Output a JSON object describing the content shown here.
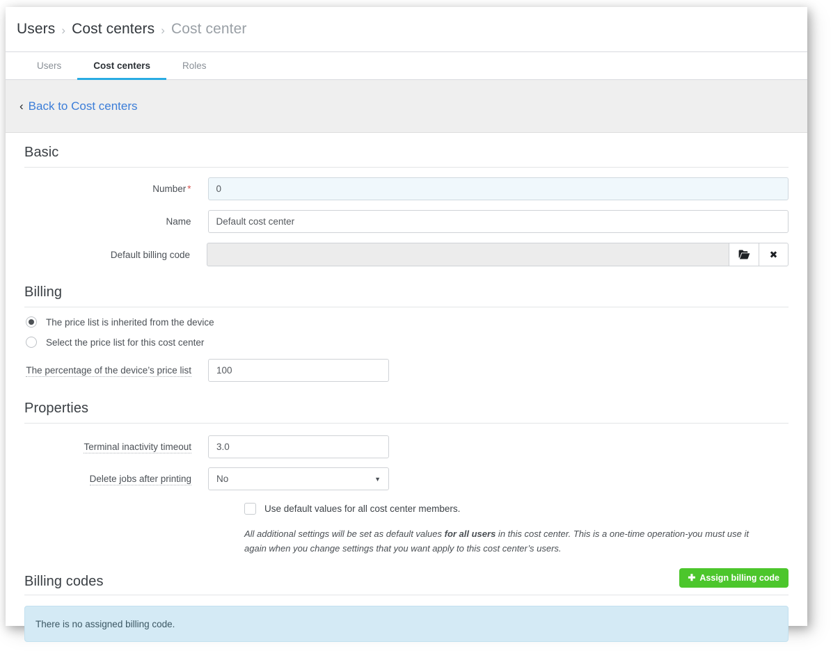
{
  "breadcrumb": {
    "items": [
      {
        "label": "Users",
        "current": false
      },
      {
        "label": "Cost centers",
        "current": false
      },
      {
        "label": "Cost center",
        "current": true
      }
    ],
    "separator": "›"
  },
  "tabs": [
    {
      "label": "Users",
      "active": false
    },
    {
      "label": "Cost centers",
      "active": true
    },
    {
      "label": "Roles",
      "active": false
    }
  ],
  "back_link": {
    "chevron": "‹",
    "label": "Back to Cost centers"
  },
  "basic": {
    "title": "Basic",
    "number": {
      "label": "Number",
      "required_marker": "*",
      "value": "0"
    },
    "name": {
      "label": "Name",
      "value": "Default cost center"
    },
    "default_billing_code": {
      "label": "Default billing code",
      "value": "",
      "browse_icon": "folder-open-icon",
      "clear_icon": "close-icon",
      "browse_glyph": "📂",
      "clear_glyph": "✖"
    }
  },
  "billing": {
    "title": "Billing",
    "options": [
      {
        "label": "The price list is inherited from the device",
        "selected": true
      },
      {
        "label": "Select the price list for this cost center",
        "selected": false
      }
    ],
    "percentage": {
      "label": "The percentage of the device’s price list",
      "value": "100"
    }
  },
  "properties": {
    "title": "Properties",
    "terminal_timeout": {
      "label": "Terminal inactivity timeout",
      "value": "3.0"
    },
    "delete_jobs": {
      "label": "Delete jobs after printing",
      "value": "No",
      "caret": "▼"
    },
    "use_defaults": {
      "label": "Use default values for all cost center members.",
      "checked": false
    },
    "help_text_1": "All additional settings will be set as default values ",
    "help_text_bold": "for all users",
    "help_text_2": " in this cost center. This is a one-time operation-you must use it again when you change settings that you want apply to this cost center’s users."
  },
  "billing_codes": {
    "title": "Billing codes",
    "assign_button": {
      "label": "Assign billing code",
      "plus": "✚"
    },
    "empty_message": "There is no assigned billing code."
  },
  "colors": {
    "accent_tab": "#29abe2",
    "link": "#3b7dd8",
    "green_button": "#4cc62c",
    "required_star": "#d9534f",
    "info_alert_bg": "#d4eaf5",
    "highlight_field_bg": "#f0f8fc"
  }
}
